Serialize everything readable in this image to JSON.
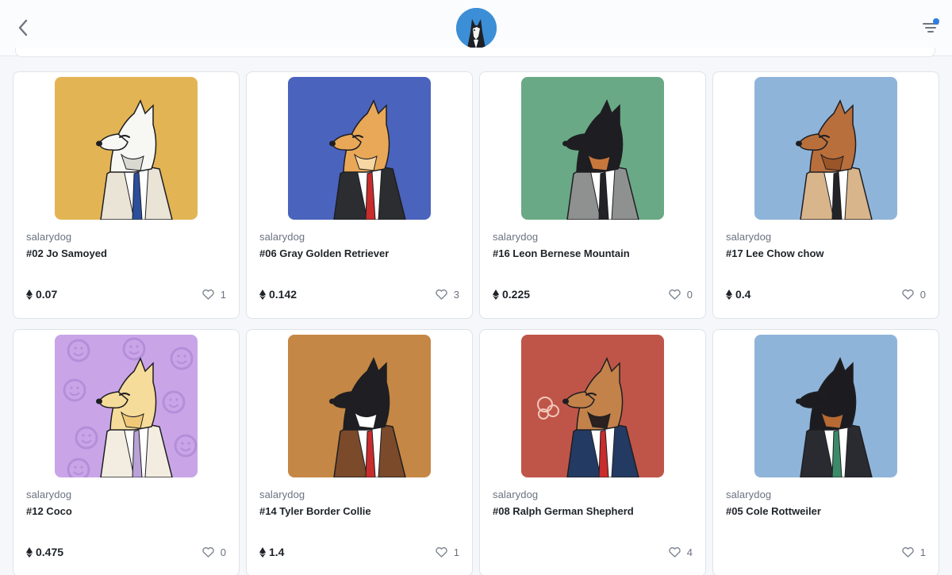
{
  "header": {
    "back_icon": "chevron-left-icon",
    "avatar_icon": "husky-avatar",
    "filter_icon": "filter-icon",
    "accent": "#2f7de1"
  },
  "cards": [
    {
      "collection": "salarydog",
      "title": "#02 Jo Samoyed",
      "price": "0.07",
      "likes": "1",
      "bg": "#e2b454",
      "fur": "#f7f7f4",
      "accent_fur": "#d9d9d2",
      "suit": "#e9e4d6",
      "tie": "#2c4f9c",
      "shirt": "#ffffff"
    },
    {
      "collection": "salarydog",
      "title": "#06 Gray Golden Retriever",
      "price": "0.142",
      "likes": "3",
      "bg": "#4a63bd",
      "fur": "#e8a857",
      "accent_fur": "#f6d7a3",
      "suit": "#2b2d31",
      "tie": "#c92c2c",
      "shirt": "#ffffff"
    },
    {
      "collection": "salarydog",
      "title": "#16 Leon Bernese Mountain",
      "price": "0.225",
      "likes": "0",
      "bg": "#69a985",
      "fur": "#1e1e22",
      "accent_fur": "#c8773b",
      "suit": "#8f9190",
      "tie": "#232327",
      "shirt": "#ffffff"
    },
    {
      "collection": "salarydog",
      "title": "#17 Lee Chow chow",
      "price": "0.4",
      "likes": "0",
      "bg": "#8fb4d9",
      "fur": "#b96f3c",
      "accent_fur": "#9a5528",
      "suit": "#d9b58c",
      "tie": "#222326",
      "shirt": "#ffffff"
    },
    {
      "collection": "salarydog",
      "title": "#12 Coco",
      "price": "0.475",
      "likes": "0",
      "bg": "#c9a5e8",
      "fur": "#f6dc9a",
      "accent_fur": "#f0c978",
      "suit": "#f3ede1",
      "tie": "#b8a2d6",
      "shirt": "#ffffff"
    },
    {
      "collection": "salarydog",
      "title": "#14 Tyler Border Collie",
      "price": "1.4",
      "likes": "1",
      "bg": "#c58745",
      "fur": "#1f1f23",
      "accent_fur": "#ffffff",
      "suit": "#7a4a2a",
      "tie": "#c92c2c",
      "shirt": "#ffffff"
    },
    {
      "collection": "salarydog",
      "title": "#08 Ralph German Shepherd",
      "price": "",
      "likes": "4",
      "bg": "#bf5549",
      "fur": "#c3824a",
      "accent_fur": "#2a2220",
      "suit": "#233a63",
      "tie": "#c92c2c",
      "shirt": "#ffffff"
    },
    {
      "collection": "salarydog",
      "title": "#05 Cole Rottweiler",
      "price": "",
      "likes": "1",
      "bg": "#8fb4d9",
      "fur": "#1c1c20",
      "accent_fur": "#b76a33",
      "suit": "#2a2b30",
      "tie": "#3b8a6a",
      "shirt": "#ffffff"
    }
  ]
}
